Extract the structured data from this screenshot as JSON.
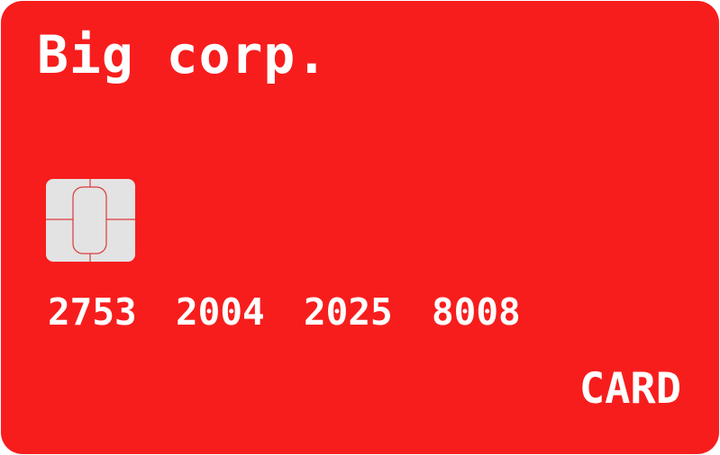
{
  "card": {
    "brand": "Big corp.",
    "number_groups": [
      "2753",
      "2004",
      "2025",
      "8008"
    ],
    "label": "CARD",
    "chip_icon": "emv-chip-icon"
  },
  "colors": {
    "card_background": "#f71d1d",
    "text": "#ffffff",
    "chip_fill": "#e3e3e3",
    "chip_lines": "#d93b3b"
  }
}
